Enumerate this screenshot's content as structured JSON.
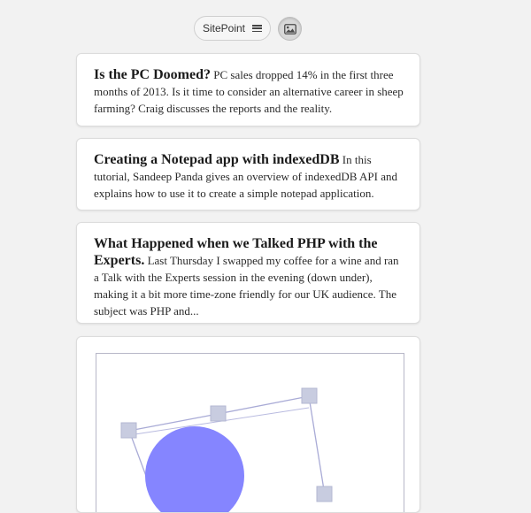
{
  "header": {
    "source_label": "SitePoint",
    "source_menu_icon": "hamburger-menu-icon",
    "image_toggle_icon": "image-icon"
  },
  "articles": [
    {
      "title": "Is the PC Doomed?",
      "summary": "PC sales dropped 14% in the first three months of 2013. Is it time to consider an alternative career in sheep farming? Craig discusses the reports and the reality."
    },
    {
      "title": "Creating a Notepad app with indexedDB",
      "summary": "In this tutorial, Sandeep Panda gives an overview of indexedDB API and explains how to use it to create a simple notepad application."
    },
    {
      "title": "What Happened when we Talked PHP with the Experts.",
      "summary": "Last Thursday I swapped my coffee for a wine and ran a Talk with the Experts session in the evening (down under), making it a bit more time-zone friendly for our UK audience. The subject was PHP and..."
    }
  ],
  "image_card": {
    "illustration": "blue-circle-with-transform-handles",
    "colors": {
      "circle": "#8585ff",
      "handle": "#c8cce0",
      "frame": "#b7b7c8",
      "guide_line": "#a9abd6"
    }
  }
}
